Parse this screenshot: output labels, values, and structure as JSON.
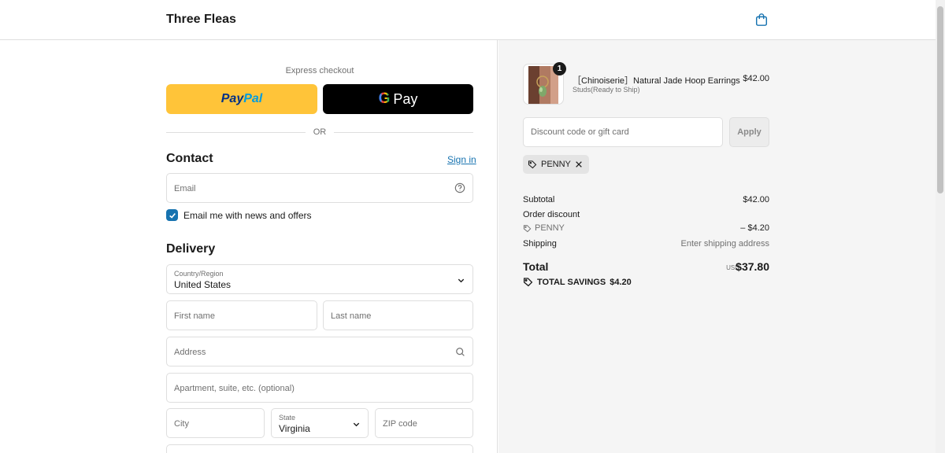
{
  "header": {
    "brand": "Three Fleas"
  },
  "express": {
    "label": "Express checkout",
    "paypal_text_1": "Pay",
    "paypal_text_2": "Pal",
    "gpay_g": "G",
    "gpay_label": "Pay",
    "or_label": "OR"
  },
  "contact": {
    "title": "Contact",
    "sign_in": "Sign in",
    "email_placeholder": "Email",
    "newsletter_label": "Email me with news and offers"
  },
  "delivery": {
    "title": "Delivery",
    "country_label": "Country/Region",
    "country_value": "United States",
    "first_name_placeholder": "First name",
    "last_name_placeholder": "Last name",
    "address_placeholder": "Address",
    "apartment_placeholder": "Apartment, suite, etc. (optional)",
    "city_placeholder": "City",
    "state_label": "State",
    "state_value": "Virginia",
    "zip_placeholder": "ZIP code"
  },
  "order": {
    "item": {
      "quantity": "1",
      "name": "［Chinoiserie］Natural Jade Hoop Earrings",
      "variant": "Studs(Ready to Ship)",
      "price": "$42.00"
    },
    "discount_placeholder": "Discount code or gift card",
    "apply_label": "Apply",
    "applied_code": "PENNY",
    "subtotal_label": "Subtotal",
    "subtotal_value": "$42.00",
    "order_discount_label": "Order discount",
    "discount_code": "PENNY",
    "discount_value": "– $4.20",
    "shipping_label": "Shipping",
    "shipping_value": "Enter shipping address",
    "total_label": "Total",
    "currency": "USD",
    "total_value": "$37.80",
    "savings_label": "TOTAL SAVINGS",
    "savings_value": "$4.20"
  },
  "colors": {
    "accent": "#1773b0",
    "paypal": "#ffc439",
    "gpay": "#000000",
    "summary_bg": "#f5f5f5"
  }
}
